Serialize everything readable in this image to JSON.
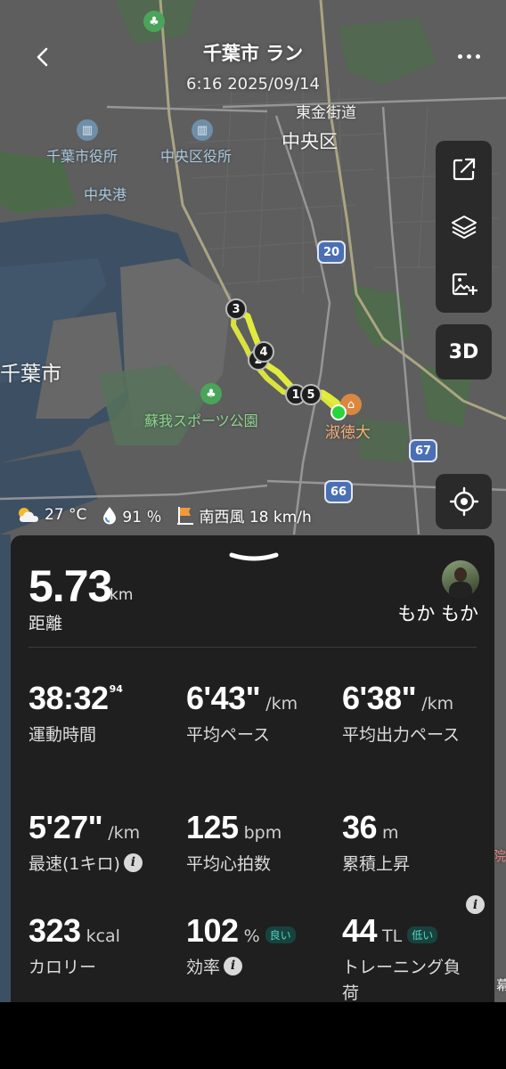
{
  "header": {
    "title": "千葉市 ラン",
    "subtitle": "6:16 2025/09/14"
  },
  "map": {
    "labels": {
      "higashi_kaido": "東金街道",
      "chuo_ku": "中央区",
      "chiba_city_office": "千葉市役所",
      "chuo_ward_office": "中央区役所",
      "chuo_port": "中央港",
      "chiba_city": "千葉市",
      "soga_park": "蘇我スポーツ公園",
      "shukutoku": "淑徳大",
      "edge_right": "院",
      "edge_right2": "幕"
    },
    "road_shields": [
      "20",
      "67",
      "66"
    ],
    "route_markers": [
      "3",
      "4",
      "2",
      "1",
      "5"
    ],
    "route_color": "#e8f23a",
    "start_color": "#27d53c"
  },
  "toolbar": {
    "btn_3d": "3D",
    "icons": [
      "share-icon",
      "layers-icon",
      "add-image-icon"
    ]
  },
  "weather": {
    "temp": "27 °C",
    "humidity": "91 ％",
    "wind": "南西風 18 km/h"
  },
  "summary": {
    "distance": "5.73",
    "distance_unit": "km",
    "distance_label": "距離",
    "user_name": "もか もか"
  },
  "stats": {
    "time_value": "38:32",
    "time_sup": "94",
    "time_label": "運動時間",
    "pace_value": "6'43\"",
    "pace_unit": "/km",
    "pace_label": "平均ペース",
    "power_pace_value": "6'38\"",
    "power_pace_unit": "/km",
    "power_pace_label": "平均出力ペース",
    "fastest_value": "5'27\"",
    "fastest_unit": "/km",
    "fastest_label": "最速(1キロ)",
    "hr_value": "125",
    "hr_unit": "bpm",
    "hr_label": "平均心拍数",
    "climb_value": "36",
    "climb_unit": "m",
    "climb_label": "累積上昇",
    "cal_value": "323",
    "cal_unit": "kcal",
    "cal_label": "カロリー",
    "eff_value": "102",
    "eff_unit": "%",
    "eff_badge": "良い",
    "eff_label": "効率",
    "tl_value": "44",
    "tl_unit": "TL",
    "tl_badge": "低い",
    "tl_label": "トレーニング負荷"
  },
  "colors": {
    "panel_bg": "#1f1f1f",
    "badge_text": "#58d4c2",
    "button_bg": "#2a2a2a"
  }
}
